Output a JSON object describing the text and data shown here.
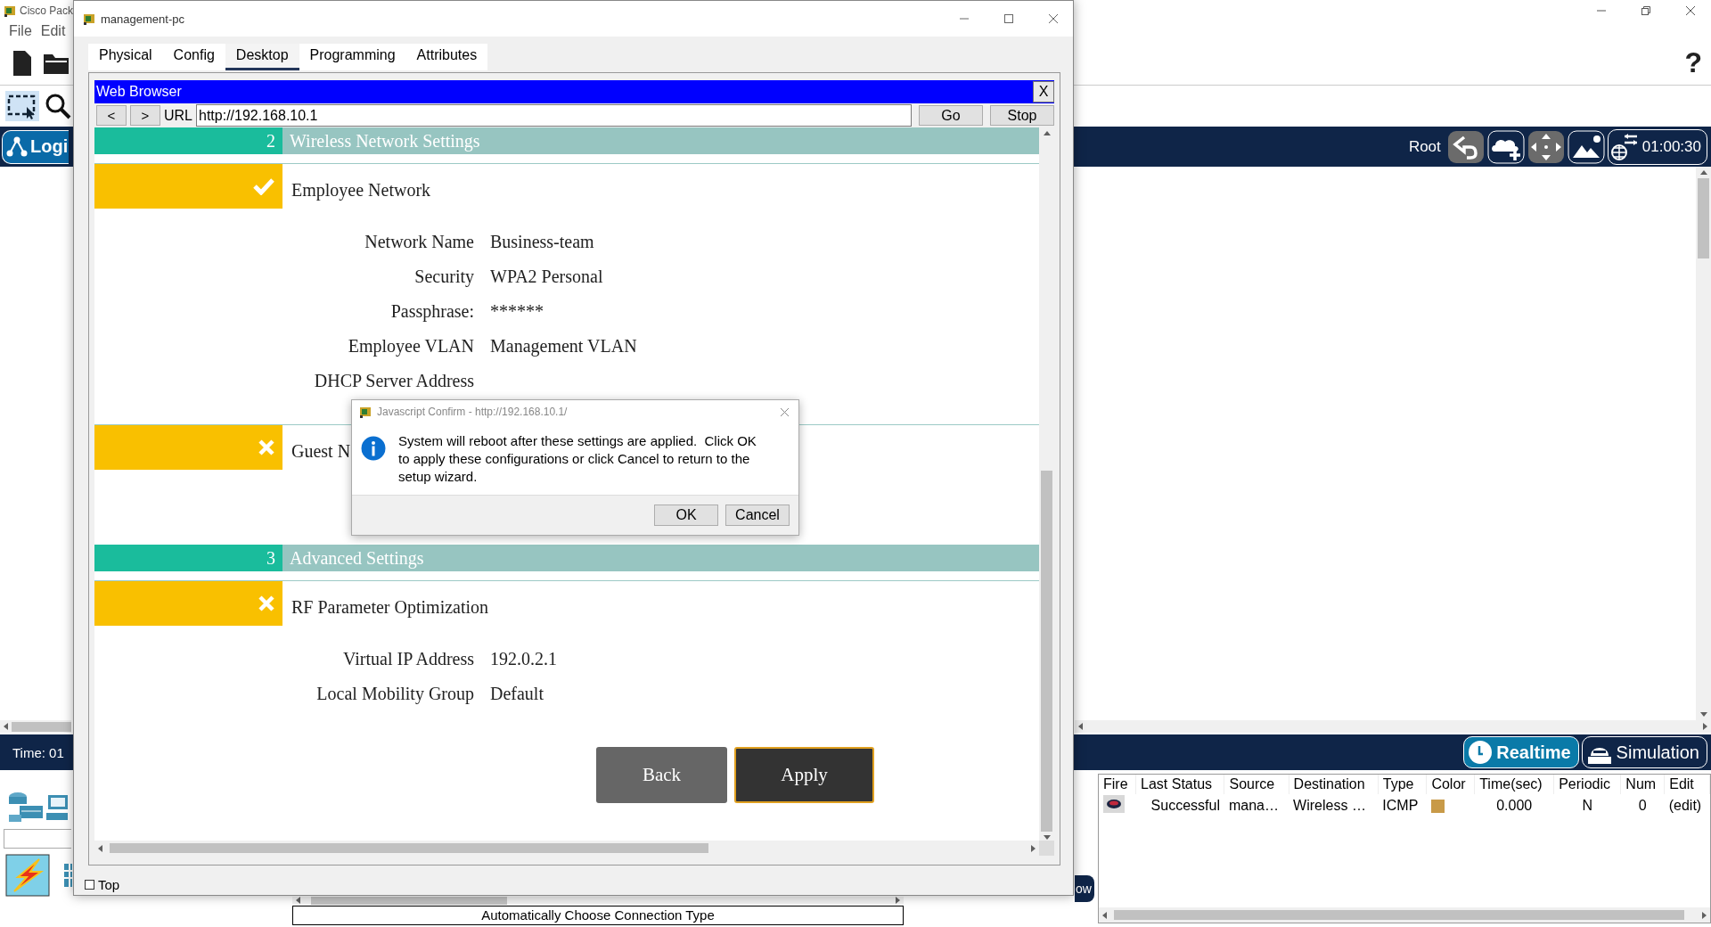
{
  "app": {
    "title": "Cisco Pack",
    "menu": [
      "File",
      "Edit"
    ],
    "help_label": "?"
  },
  "top_bar": {
    "logical_label": "Logi",
    "root_label": "Root",
    "clock": "01:00:30"
  },
  "time_bar": {
    "time_label": "Time: 01",
    "modes": [
      {
        "label": "Realtime",
        "kind": "realtime",
        "selected": true
      },
      {
        "label": "Simulation",
        "kind": "simulation",
        "selected": false
      }
    ]
  },
  "connection_type": "Automatically Choose Connection Type",
  "pdu_list_button": "ow",
  "pdu_table": {
    "columns": [
      "Fire",
      "Last Status",
      "Source",
      "Destination",
      "Type",
      "Color",
      "Time(sec)",
      "Periodic",
      "Num",
      "Edit"
    ],
    "rows": [
      {
        "last_status": "Successful",
        "source": "mana…",
        "destination": "Wireless …",
        "type": "ICMP",
        "color": "#c89a48",
        "time": "0.000",
        "periodic": "N",
        "num": "0",
        "edit": "(edit)"
      }
    ]
  },
  "device_window": {
    "title": "management-pc",
    "tabs": [
      {
        "label": "Physical",
        "selected": false
      },
      {
        "label": "Config",
        "selected": false
      },
      {
        "label": "Desktop",
        "selected": true
      },
      {
        "label": "Programming",
        "selected": false
      },
      {
        "label": "Attributes",
        "selected": false
      }
    ],
    "browser": {
      "title": "Web Browser",
      "close": "X",
      "back": "<",
      "forward": ">",
      "url_label": "URL",
      "url": "http://192.168.10.1",
      "go": "Go",
      "stop": "Stop",
      "sections": [
        {
          "kind": "band",
          "number": "2",
          "title": "Wireless Network Settings"
        },
        {
          "kind": "group",
          "done": true,
          "title": "Employee Network",
          "fields": [
            {
              "label": "Network Name",
              "value": "Business-team"
            },
            {
              "label": "Security",
              "value": "WPA2 Personal"
            },
            {
              "label": "Passphrase:",
              "value": "******"
            },
            {
              "label": "Employee VLAN",
              "value": "Management VLAN"
            },
            {
              "label": "DHCP Server Address"
            }
          ]
        },
        {
          "kind": "group",
          "done": false,
          "title": "Guest N"
        },
        {
          "kind": "band",
          "number": "3",
          "title": "Advanced Settings"
        },
        {
          "kind": "group",
          "done": false,
          "title": "RF Parameter Optimization",
          "fields": [
            {
              "label": "Virtual IP Address",
              "value": "192.0.2.1"
            },
            {
              "label": "Local Mobility Group",
              "value": "Default"
            }
          ]
        }
      ],
      "buttons": [
        {
          "label": "Back",
          "focused": false
        },
        {
          "label": "Apply",
          "focused": true
        }
      ]
    },
    "top_checkbox": {
      "label": "Top",
      "checked": false
    }
  },
  "dialog": {
    "title": "Javascript Confirm - http://192.168.10.1/",
    "message": "System will reboot after these settings are applied.  Click OK to apply these configurations or click Cancel to return to the setup wizard.",
    "buttons": [
      "OK",
      "Cancel"
    ]
  }
}
